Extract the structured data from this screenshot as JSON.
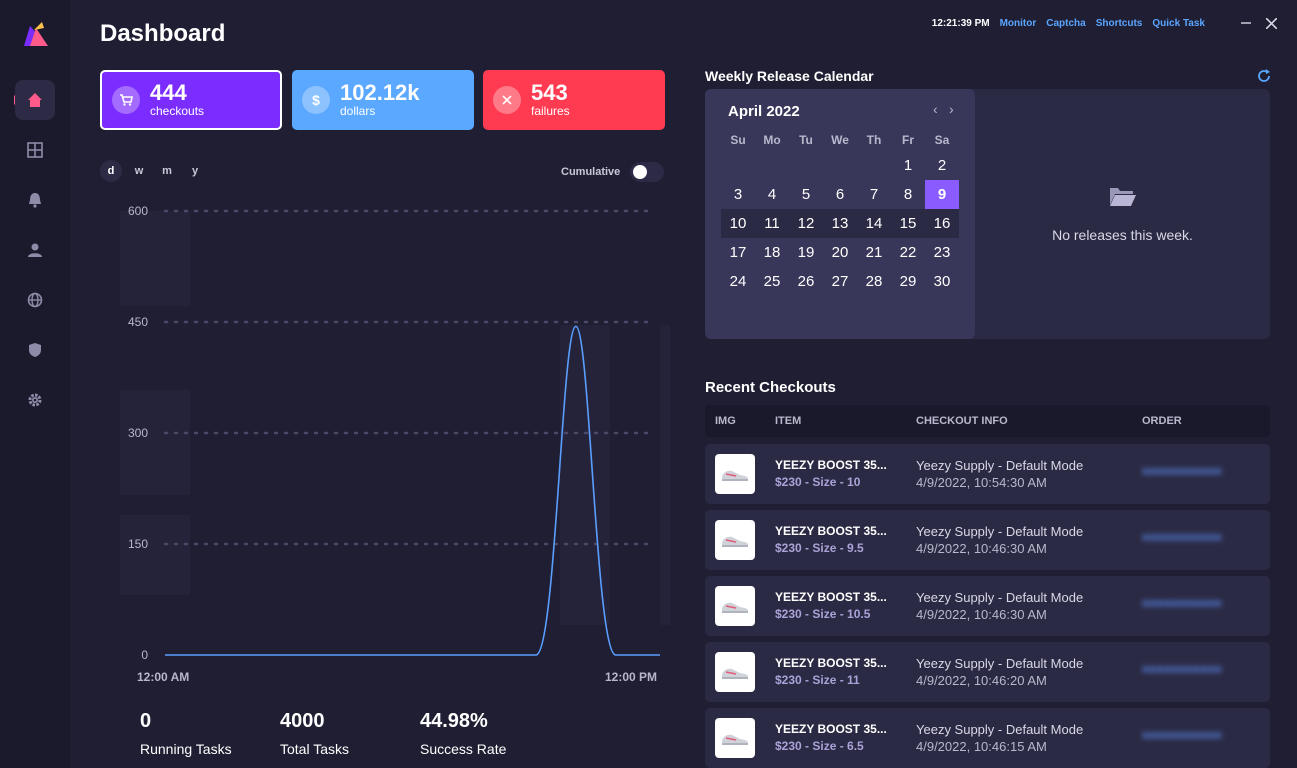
{
  "header": {
    "title": "Dashboard",
    "clock": "12:21:39 PM",
    "links": [
      "Monitor",
      "Captcha",
      "Shortcuts",
      "Quick Task"
    ]
  },
  "stats": {
    "checkouts": {
      "value": "444",
      "label": "checkouts",
      "icon": "cart-icon"
    },
    "dollars": {
      "value": "102.12k",
      "label": "dollars",
      "icon": "dollar-icon"
    },
    "failures": {
      "value": "543",
      "label": "failures",
      "icon": "close-icon"
    }
  },
  "ranges": {
    "items": [
      "d",
      "w",
      "m",
      "y"
    ],
    "selected": "d"
  },
  "cumulative": {
    "label": "Cumulative",
    "on": false
  },
  "chart_data": {
    "type": "line",
    "x": [
      "12:00 AM",
      "12:00 PM"
    ],
    "yticks": [
      0,
      150,
      300,
      450,
      600
    ],
    "ylim": [
      0,
      600
    ],
    "peak": {
      "value": 444
    },
    "series": [
      {
        "values": [
          0,
          0,
          0,
          0,
          0,
          0,
          0,
          0,
          0,
          444,
          0,
          0
        ]
      }
    ],
    "grid": true,
    "color": "#5a9fff"
  },
  "bottom": {
    "running": {
      "value": "0",
      "label": "Running Tasks"
    },
    "total": {
      "value": "4000",
      "label": "Total Tasks"
    },
    "success": {
      "value": "44.98%",
      "label": "Success Rate"
    }
  },
  "calendar": {
    "title": "Weekly Release Calendar",
    "month": "April 2022",
    "weekdays": [
      "Su",
      "Mo",
      "Tu",
      "We",
      "Th",
      "Fr",
      "Sa"
    ],
    "days": [
      "",
      "",
      "",
      "",
      "",
      "1",
      "2",
      "3",
      "4",
      "5",
      "6",
      "7",
      "8",
      "9",
      "10",
      "11",
      "12",
      "13",
      "14",
      "15",
      "16",
      "17",
      "18",
      "19",
      "20",
      "21",
      "22",
      "23",
      "24",
      "25",
      "26",
      "27",
      "28",
      "29",
      "30"
    ],
    "selected": "9",
    "empty_message": "No releases this week."
  },
  "checkouts": {
    "title": "Recent Checkouts",
    "columns": [
      "IMG",
      "ITEM",
      "CHECKOUT INFO",
      "ORDER"
    ],
    "rows": [
      {
        "item": "YEEZY BOOST 35...",
        "price": "$230 - Size - 10",
        "mode": "Yeezy Supply - Default Mode",
        "time": "4/9/2022, 10:54:30 AM"
      },
      {
        "item": "YEEZY BOOST 35...",
        "price": "$230 - Size - 9.5",
        "mode": "Yeezy Supply - Default Mode",
        "time": "4/9/2022, 10:46:30 AM"
      },
      {
        "item": "YEEZY BOOST 35...",
        "price": "$230 - Size - 10.5",
        "mode": "Yeezy Supply - Default Mode",
        "time": "4/9/2022, 10:46:30 AM"
      },
      {
        "item": "YEEZY BOOST 35...",
        "price": "$230 - Size - 11",
        "mode": "Yeezy Supply - Default Mode",
        "time": "4/9/2022, 10:46:20 AM"
      },
      {
        "item": "YEEZY BOOST 35...",
        "price": "$230 - Size - 6.5",
        "mode": "Yeezy Supply - Default Mode",
        "time": "4/9/2022, 10:46:15 AM"
      }
    ]
  }
}
